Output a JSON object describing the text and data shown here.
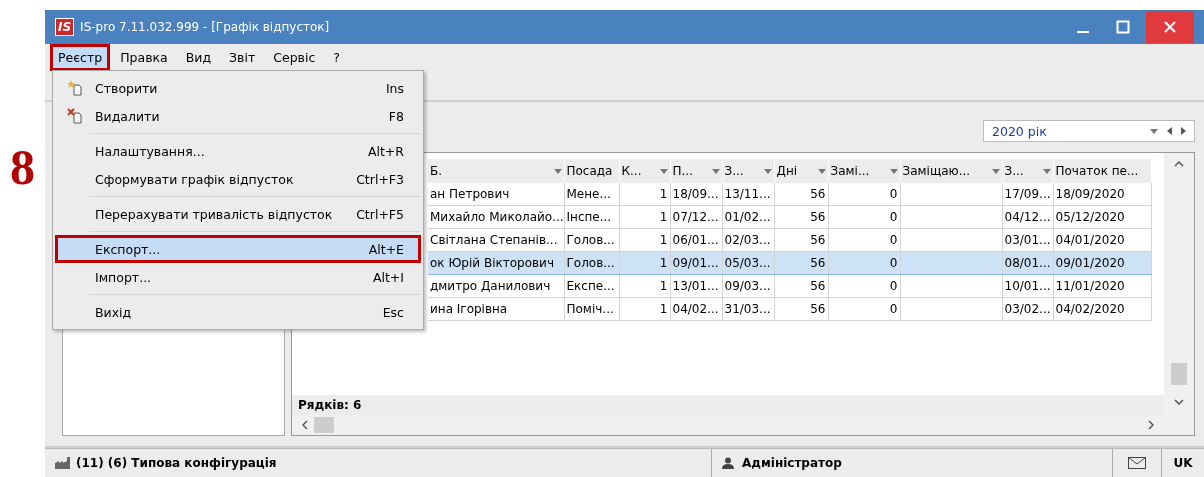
{
  "step_label": "8",
  "window": {
    "title": "IS-pro 7.11.032.999 - [Графік відпусток]",
    "logo": "IS"
  },
  "menubar": [
    {
      "label": "Реєстр",
      "selected": true,
      "marked": true
    },
    {
      "label": "Правка",
      "selected": false,
      "marked": false
    },
    {
      "label": "Вид",
      "selected": false,
      "marked": false
    },
    {
      "label": "Звіт",
      "selected": false,
      "marked": false
    },
    {
      "label": "Сервіс",
      "selected": false,
      "marked": false
    },
    {
      "label": "?",
      "selected": false,
      "marked": false
    }
  ],
  "menu": {
    "groups": [
      [
        {
          "label": "Створити",
          "shortcut": "Ins",
          "kind": "create",
          "selected": false,
          "marked": false
        },
        {
          "label": "Видалити",
          "shortcut": "F8",
          "kind": "delete",
          "selected": false,
          "marked": false
        }
      ],
      [
        {
          "label": "Налаштування...",
          "shortcut": "Alt+R",
          "selected": false,
          "marked": false
        },
        {
          "label": "Сформувати графік відпусток",
          "shortcut": "Ctrl+F3",
          "selected": false,
          "marked": false
        }
      ],
      [
        {
          "label": "Перерахувати тривалість відпусток",
          "shortcut": "Ctrl+F5",
          "selected": false,
          "marked": false
        }
      ],
      [
        {
          "label": "Експорт...",
          "shortcut": "Alt+E",
          "selected": true,
          "marked": true
        },
        {
          "label": "Імпорт...",
          "shortcut": "Alt+I",
          "selected": false,
          "marked": false
        }
      ],
      [
        {
          "label": "Вихід",
          "shortcut": "Esc",
          "selected": false,
          "marked": false
        }
      ]
    ]
  },
  "year_selector": {
    "value": "2020 рік"
  },
  "table": {
    "columns": [
      {
        "label": "Б.",
        "kind": "text",
        "filter_button": true
      },
      {
        "label": "Посада",
        "kind": "text",
        "filter_button": false
      },
      {
        "label": "К...",
        "kind": "number",
        "filter_button": true
      },
      {
        "label": "П...",
        "kind": "text",
        "filter_button": true
      },
      {
        "label": "З...",
        "kind": "text",
        "filter_button": true
      },
      {
        "label": "Дні",
        "kind": "number",
        "filter_button": true
      },
      {
        "label": "Замі...",
        "kind": "number",
        "filter_button": true
      },
      {
        "label": "Заміщаю...",
        "kind": "text",
        "filter_button": true
      },
      {
        "label": "З...",
        "kind": "text",
        "filter_button": true
      },
      {
        "label": "Початок пе...",
        "kind": "text",
        "filter_button": false
      }
    ],
    "rows": [
      {
        "selected": false,
        "cells": [
          "ан Петрович",
          "Мене...",
          "1",
          "18/09...",
          "13/11...",
          "56",
          "0",
          null,
          "17/09...",
          "18/09/2020"
        ]
      },
      {
        "selected": false,
        "cells": [
          "Михайло Миколайо...",
          "Інспе...",
          "1",
          "07/12...",
          "01/02...",
          "56",
          "0",
          null,
          "04/12...",
          "05/12/2020"
        ]
      },
      {
        "selected": false,
        "cells": [
          "Світлана Степанів...",
          "Голов...",
          "1",
          "06/01...",
          "02/03...",
          "56",
          "0",
          null,
          "03/01...",
          "04/01/2020"
        ]
      },
      {
        "selected": true,
        "cells": [
          "ок Юрій Вікторович",
          "Голов...",
          "1",
          "09/01...",
          "05/03...",
          "56",
          "0",
          null,
          "08/01...",
          "09/01/2020"
        ]
      },
      {
        "selected": false,
        "cells": [
          "дмитро Данилович",
          "Експе...",
          "1",
          "13/01...",
          "09/03...",
          "56",
          "0",
          null,
          "10/01...",
          "11/01/2020"
        ]
      },
      {
        "selected": false,
        "cells": [
          "ина Ігорівна",
          "Поміч...",
          "1",
          "04/02...",
          "31/03...",
          "56",
          "0",
          null,
          "03/02...",
          "04/02/2020"
        ]
      }
    ],
    "footer": "Рядків: 6"
  },
  "status_bar": {
    "configuration": "(11) (6) Типова конфігурація",
    "user": "Адміністратор",
    "language": "UK"
  }
}
